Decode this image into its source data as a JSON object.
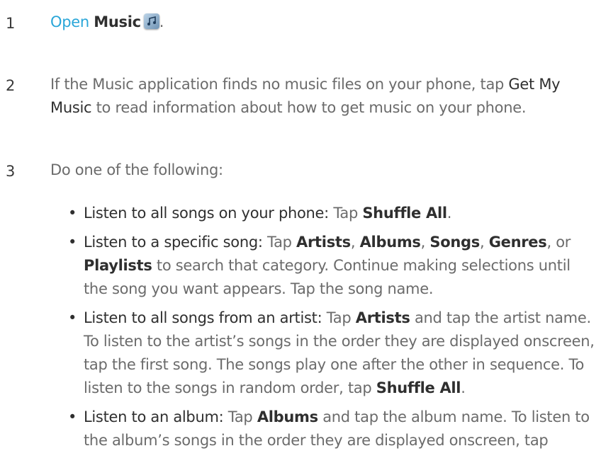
{
  "steps": [
    {
      "number": "1",
      "open_link": "Open",
      "app_name": "Music",
      "app_icon": "music-app-icon",
      "period": "."
    },
    {
      "number": "2",
      "text_before": "If the Music application finds no music files on your phone, tap ",
      "button_name": "Get My Music",
      "text_after": " to read information about how to get music on your phone."
    },
    {
      "number": "3",
      "text": "Do one of the following:"
    }
  ],
  "bullets": [
    {
      "lead": "Listen to all songs on your phone:",
      "t1": " Tap ",
      "b1": "Shuffle All",
      "t2": "."
    },
    {
      "lead": "Listen to a specific song:",
      "t1": " Tap ",
      "b1": "Artists",
      "s1": ", ",
      "b2": "Albums",
      "s2": ", ",
      "b3": "Songs",
      "s3": ", ",
      "b4": "Genres",
      "s4": ", or ",
      "b5": "Playlists",
      "t2": " to search that category. Continue making selections until the song you want appears. Tap the song name."
    },
    {
      "lead": "Listen to all songs from an artist:",
      "t1": " Tap ",
      "b1": "Artists",
      "t2": " and tap the artist name. To listen to the artist’s songs in the order they are displayed onscreen, tap the first song. The songs play one after the other in sequence. To listen to the songs in random order, tap ",
      "b2": "Shuffle All",
      "t3": "."
    },
    {
      "lead": "Listen to an album:",
      "t1": " Tap ",
      "b1": "Albums",
      "t2": " and tap the album name. To listen to the album’s songs in the order they are displayed onscreen, tap"
    }
  ],
  "colors": {
    "link": "#2aa6d8",
    "text": "#6b6b6b",
    "emphasis": "#2f2f2f"
  }
}
